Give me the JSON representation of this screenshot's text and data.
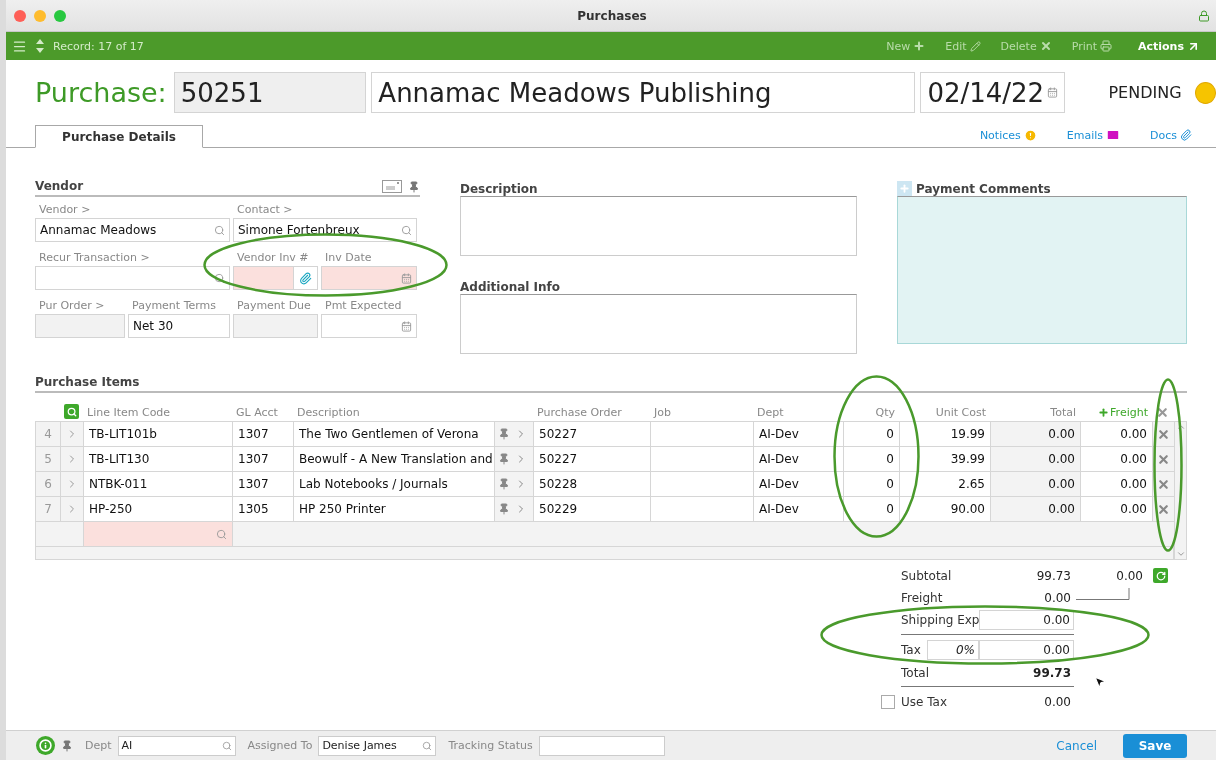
{
  "window": {
    "title": "Purchases"
  },
  "toolbar": {
    "record": "Record: 17 of 17",
    "actions": [
      {
        "label": "New",
        "kind": "new",
        "disabled": true
      },
      {
        "label": "Edit",
        "kind": "edit",
        "disabled": true
      },
      {
        "label": "Delete",
        "kind": "delete",
        "disabled": true
      },
      {
        "label": "Print",
        "kind": "print",
        "disabled": true
      },
      {
        "label": "Actions",
        "kind": "actions",
        "disabled": false
      }
    ]
  },
  "header": {
    "label": "Purchase:",
    "number": "50251",
    "name": "Annamac Meadows Publishing",
    "date": "02/14/22",
    "status": "PENDING"
  },
  "tabs": [
    {
      "label": "Purchase Details",
      "selected": true
    }
  ],
  "links": [
    {
      "label": "Notices",
      "kind": "notices"
    },
    {
      "label": "Emails",
      "kind": "emails"
    },
    {
      "label": "Docs",
      "kind": "docs"
    }
  ],
  "vendor": {
    "title": "Vendor",
    "fields": [
      {
        "label": "Vendor >",
        "value": "Annamac Meadows",
        "kind": "search",
        "required": false,
        "readonly": false
      },
      {
        "label": "Contact >",
        "value": "Simone Fortenbreux",
        "kind": "search",
        "required": false,
        "readonly": false
      },
      {
        "label": "Recur Transaction >",
        "kind": "search",
        "required": false,
        "readonly": false
      },
      {
        "label": "Vendor Inv #",
        "kind": "attach",
        "required": true,
        "readonly": false
      },
      {
        "label": "Inv Date",
        "kind": "date",
        "required": true,
        "readonly": false
      },
      {
        "label": "Pur Order >",
        "kind": "text",
        "required": false,
        "readonly": true
      },
      {
        "label": "Payment Terms",
        "value": "Net 30",
        "kind": "text",
        "required": false,
        "readonly": false
      },
      {
        "label": "Payment Due",
        "kind": "text",
        "required": false,
        "readonly": true
      },
      {
        "label": "Pmt Expected",
        "kind": "date",
        "required": false,
        "readonly": false
      }
    ]
  },
  "notes": [
    {
      "title": "Description"
    },
    {
      "title": "Additional Info"
    }
  ],
  "payment_comments": {
    "title": "Payment Comments"
  },
  "items": {
    "title": "Purchase Items",
    "columns": [
      "Line Item Code",
      "GL Acct",
      "Description",
      "Purchase Order",
      "Job",
      "Dept",
      "Qty",
      "Unit Cost",
      "Total",
      "Freight"
    ],
    "rows": [
      {
        "num": "4",
        "code": "TB-LIT101b",
        "gl": "1307",
        "description": "The Two Gentlemen of Verona",
        "po": "50227",
        "dept": "AI-Dev",
        "qty": "0",
        "unit_cost": "19.99",
        "total": "0.00",
        "freight": "0.00"
      },
      {
        "num": "5",
        "code": "TB-LIT130",
        "gl": "1307",
        "description": "Beowulf - A New Translation and",
        "po": "50227",
        "dept": "AI-Dev",
        "qty": "0",
        "unit_cost": "39.99",
        "total": "0.00",
        "freight": "0.00"
      },
      {
        "num": "6",
        "code": "NTBK-011",
        "gl": "1307",
        "description": "Lab Notebooks / Journals",
        "po": "50228",
        "dept": "AI-Dev",
        "qty": "0",
        "unit_cost": "2.65",
        "total": "0.00",
        "freight": "0.00"
      },
      {
        "num": "7",
        "code": "HP-250",
        "gl": "1305",
        "description": "HP 250 Printer",
        "po": "50229",
        "dept": "AI-Dev",
        "qty": "0",
        "unit_cost": "90.00",
        "total": "0.00",
        "freight": "0.00"
      }
    ]
  },
  "totals": {
    "subtotal": {
      "label": "Subtotal",
      "value": "99.73",
      "freight": "0.00"
    },
    "freight": {
      "label": "Freight",
      "value": "0.00"
    },
    "shipping": {
      "label": "Shipping Exp",
      "value": "0.00"
    },
    "tax": {
      "label": "Tax",
      "rate": "0%",
      "value": "0.00"
    },
    "total": {
      "label": "Total",
      "value": "99.73"
    },
    "use_tax": {
      "label": "Use Tax",
      "checked": false,
      "value": "0.00"
    }
  },
  "footer": {
    "fields": [
      {
        "label": "Dept",
        "value": "AI"
      },
      {
        "label": "Assigned To",
        "value": "Denise James"
      },
      {
        "label": "Tracking Status"
      }
    ],
    "cancel": "Cancel",
    "save": "Save"
  }
}
